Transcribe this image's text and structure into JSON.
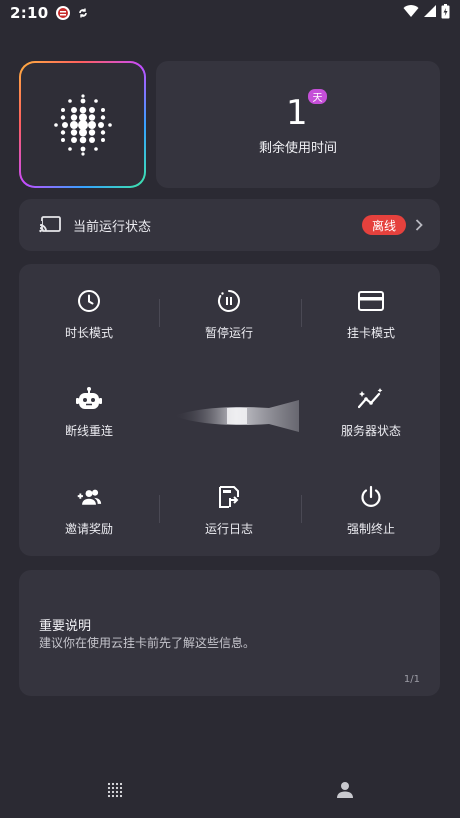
{
  "status_bar": {
    "time": "2:10",
    "icons": [
      "notification-app-icon",
      "sync-icon",
      "wifi-icon",
      "signal-icon",
      "battery-icon"
    ]
  },
  "logo": {
    "icon": "dot-sphere-icon"
  },
  "remaining": {
    "value": "1",
    "unit_badge": "天",
    "label": "剩余使用时间"
  },
  "run_status": {
    "icon": "cast-icon",
    "label": "当前运行状态",
    "badge": "离线",
    "badge_color": "#e5413d"
  },
  "grid": {
    "items": [
      {
        "label": "时长模式",
        "icon": "clock-icon"
      },
      {
        "label": "暂停运行",
        "icon": "pause-circle-icon"
      },
      {
        "label": "挂卡模式",
        "icon": "credit-card-icon"
      },
      {
        "label": "断线重连",
        "icon": "robot-icon"
      },
      {
        "label": "服务器状态",
        "icon": "chart-sparkle-icon"
      },
      {
        "label": "邀请奖励",
        "icon": "group-add-icon"
      },
      {
        "label": "运行日志",
        "icon": "log-file-icon"
      },
      {
        "label": "强制终止",
        "icon": "power-icon"
      }
    ]
  },
  "info": {
    "title": "重要说明",
    "description": "建议你在使用云挂卡前先了解这些信息。",
    "page": "1/1"
  },
  "nav": {
    "items": [
      {
        "icon": "dot-grid-icon"
      },
      {
        "icon": "person-icon"
      }
    ]
  },
  "colors": {
    "background": "#2b2a33",
    "card": "#35343e",
    "badge_purple": "#c54fd8"
  }
}
